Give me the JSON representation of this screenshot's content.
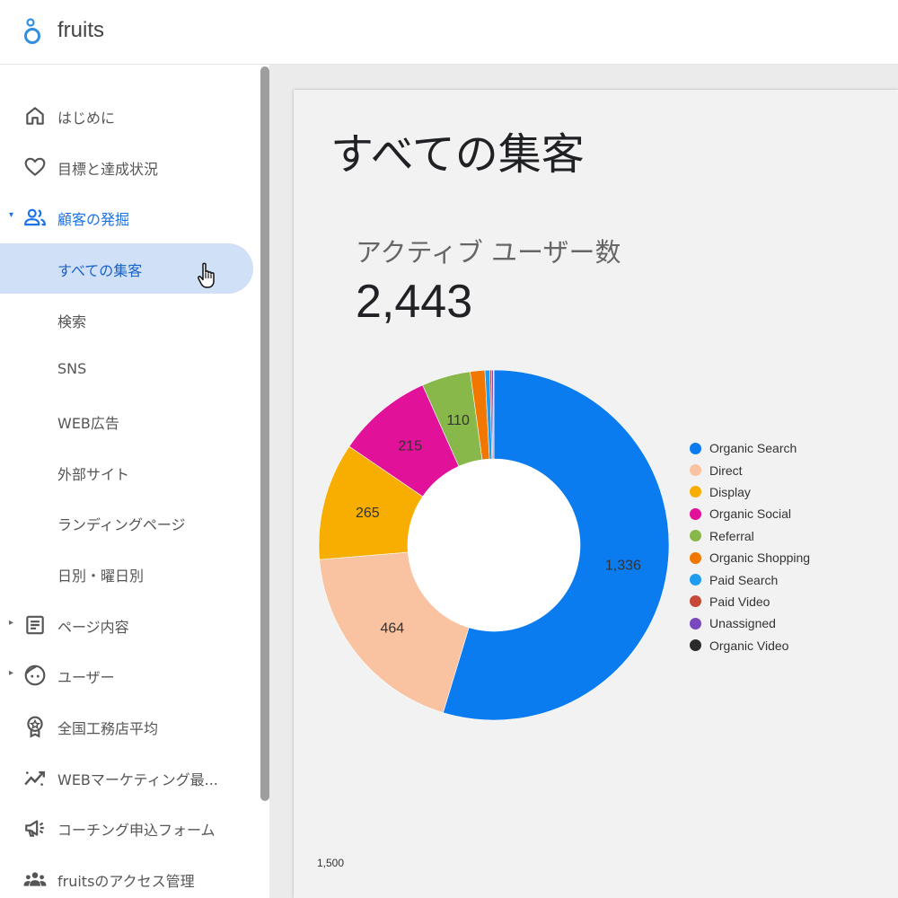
{
  "app": {
    "title": "fruits",
    "logo_icon": "fruits-logo-icon"
  },
  "sidebar": {
    "items": [
      {
        "label": "はじめに",
        "icon": "home-icon",
        "active": false
      },
      {
        "label": "目標と達成状況",
        "icon": "heart-icon",
        "active": false
      },
      {
        "label": "顧客の発掘",
        "icon": "people-icon",
        "active": false,
        "expanded": true
      },
      {
        "label": "すべての集客",
        "icon": "",
        "active": true
      },
      {
        "label": "検索",
        "icon": "",
        "active": false
      },
      {
        "label": "SNS",
        "icon": "",
        "active": false
      },
      {
        "label": "WEB広告",
        "icon": "",
        "active": false
      },
      {
        "label": "外部サイト",
        "icon": "",
        "active": false
      },
      {
        "label": "ランディングページ",
        "icon": "",
        "active": false
      },
      {
        "label": "日別・曜日別",
        "icon": "",
        "active": false
      },
      {
        "label": "ページ内容",
        "icon": "document-icon",
        "active": false,
        "expanded": false
      },
      {
        "label": "ユーザー",
        "icon": "face-icon",
        "active": false,
        "expanded": false
      },
      {
        "label": "全国工務店平均",
        "icon": "award-icon",
        "active": false
      },
      {
        "label": "WEBマーケティング最...",
        "icon": "trending-icon",
        "active": false
      },
      {
        "label": "コーチング申込フォーム",
        "icon": "megaphone-icon",
        "active": false
      },
      {
        "label": "fruitsのアクセス管理",
        "icon": "group-icon",
        "active": false
      }
    ]
  },
  "page": {
    "title": "すべての集客",
    "kpi_label": "アクティブ ユーザー数",
    "kpi_value": "2,443",
    "axis_note": "1,500"
  },
  "colors": {
    "accent": "#1a73e8",
    "active_bg": "#cfe0f7"
  },
  "chart_data": {
    "type": "pie",
    "donut": true,
    "categories": [
      "Organic Search",
      "Direct",
      "Display",
      "Organic Social",
      "Referral",
      "Organic Shopping",
      "Paid Search",
      "Paid Video",
      "Unassigned",
      "Organic Video"
    ],
    "values": [
      1336,
      464,
      265,
      215,
      110,
      33,
      11,
      4,
      4,
      1
    ],
    "data_labels": [
      "1,336",
      "464",
      "265",
      "215",
      "110",
      "",
      "",
      "",
      "",
      ""
    ],
    "colors": [
      "#0a7cef",
      "#f9c2a0",
      "#f8ae00",
      "#e2119a",
      "#89b84a",
      "#f27700",
      "#1e9cf0",
      "#c84838",
      "#7748be",
      "#2b2b2b"
    ],
    "legend_position": "right"
  }
}
